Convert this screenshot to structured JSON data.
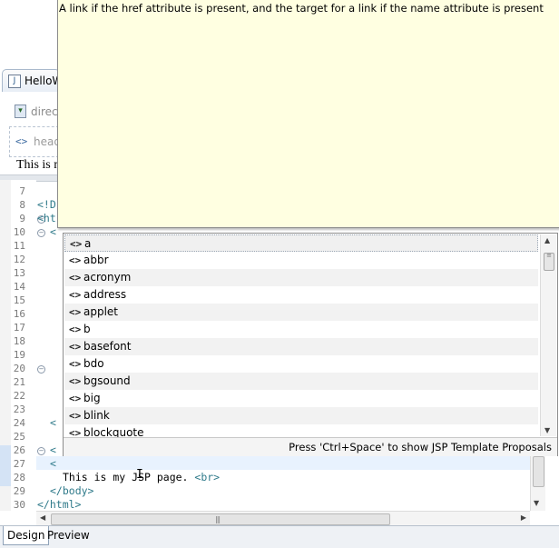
{
  "tooltip": {
    "text": "A link if the href attribute is present, and the target for a link if the name attribute is present"
  },
  "editor": {
    "tab_label": "HelloW",
    "toolbar_label": "direct",
    "design_head_label": "head",
    "design_text": "This is my",
    "gutter": {
      "line_numbers": [
        "7",
        "8",
        "9",
        "10",
        "11",
        "12",
        "13",
        "14",
        "15",
        "16",
        "17",
        "18",
        "19",
        "20",
        "21",
        "22",
        "23",
        "24",
        "25",
        "26",
        "27",
        "28",
        "29",
        "30"
      ]
    },
    "code": {
      "l8": "<!D",
      "l9": "<ht",
      "l10": "<",
      "l24": "<",
      "l26": "<",
      "l27": "<",
      "l28_text": "This is my JSP page. ",
      "l28_tag": "<br>",
      "l29": "</body>",
      "l30": "</html>"
    }
  },
  "proposals": {
    "items": [
      {
        "icon": "<>",
        "label": "a"
      },
      {
        "icon": "<>",
        "label": "abbr"
      },
      {
        "icon": "<>",
        "label": "acronym"
      },
      {
        "icon": "<>",
        "label": "address"
      },
      {
        "icon": "<>",
        "label": "applet"
      },
      {
        "icon": "<>",
        "label": "b"
      },
      {
        "icon": "<>",
        "label": "basefont"
      },
      {
        "icon": "<>",
        "label": "bdo"
      },
      {
        "icon": "<>",
        "label": "bgsound"
      },
      {
        "icon": "<>",
        "label": "big"
      },
      {
        "icon": "<>",
        "label": "blink"
      },
      {
        "icon": "<>",
        "label": "blockquote"
      }
    ],
    "status_text": "Press 'Ctrl+Space' to show JSP Template Proposals"
  },
  "mode_tabs": {
    "design": "Design",
    "preview": "Preview"
  },
  "icons": {
    "tag_icon": "angle-brackets-icon",
    "file_icon": "jsp-file-icon"
  },
  "colors": {
    "tooltip_bg": "#ffffe1",
    "tag_color": "#2f7a8a"
  }
}
